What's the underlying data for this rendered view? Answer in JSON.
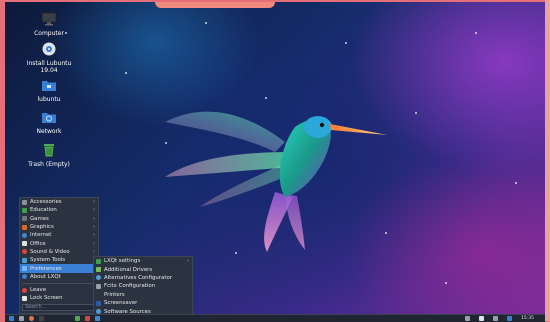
{
  "desktop": {
    "icons": [
      {
        "label": "Computer",
        "icon": "computer-icon"
      },
      {
        "label": "Install Lubuntu\n19.04",
        "icon": "disc-icon"
      },
      {
        "label": "lubuntu",
        "icon": "home-folder-icon"
      },
      {
        "label": "Network",
        "icon": "network-folder-icon"
      },
      {
        "label": "Trash (Empty)",
        "icon": "trash-icon"
      }
    ]
  },
  "menu": {
    "items": [
      {
        "label": "Accessories",
        "icon": "accessories-icon",
        "color": "#8a8f99"
      },
      {
        "label": "Education",
        "icon": "education-icon",
        "color": "#3f9e4d"
      },
      {
        "label": "Games",
        "icon": "games-icon",
        "color": "#6f757f"
      },
      {
        "label": "Graphics",
        "icon": "graphics-icon",
        "color": "#d46a2b"
      },
      {
        "label": "Internet",
        "icon": "internet-icon",
        "color": "#3a8ad6"
      },
      {
        "label": "Office",
        "icon": "office-icon",
        "color": "#e0e0e0"
      },
      {
        "label": "Sound & Video",
        "icon": "sound-video-icon",
        "color": "#d9463b"
      },
      {
        "label": "System Tools",
        "icon": "system-tools-icon",
        "color": "#4a9fd8"
      },
      {
        "label": "Preferences",
        "icon": "preferences-icon",
        "color": "#6fb6ff"
      },
      {
        "label": "About LXQt",
        "icon": "about-icon",
        "color": "#3a7fd6"
      }
    ],
    "leave": {
      "label": "Leave",
      "icon": "leave-icon",
      "color": "#d9463b"
    },
    "lock": {
      "label": "Lock Screen",
      "icon": "lock-icon",
      "color": "#e8e8e8"
    },
    "search_placeholder": "Search..."
  },
  "submenu": {
    "items": [
      {
        "label": "LXQt settings",
        "icon": "lxqt-settings-icon",
        "color": "#3f9e4d"
      },
      {
        "label": "Additional Drivers",
        "icon": "drivers-icon",
        "color": "#7bbd57"
      },
      {
        "label": "Alternatives Configurator",
        "icon": "alternatives-icon",
        "color": "#4a9fd8"
      },
      {
        "label": "Fcitx Configuration",
        "icon": "keyboard-icon",
        "color": "#9aa0aa"
      },
      {
        "label": "Printers",
        "icon": "printer-icon",
        "color": "#2b3340"
      },
      {
        "label": "Screensaver",
        "icon": "screensaver-icon",
        "color": "#2d5aa8"
      },
      {
        "label": "Software Sources",
        "icon": "software-sources-icon",
        "color": "#4a9fd8"
      }
    ]
  },
  "taskbar": {
    "clock": "15:35"
  }
}
